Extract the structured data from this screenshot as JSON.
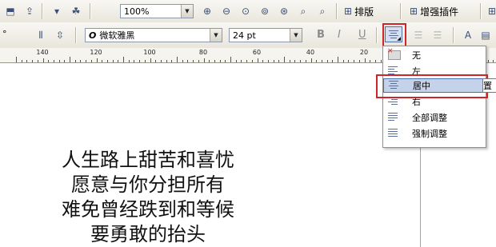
{
  "toolbar1": {
    "zoom_value": "100%",
    "layout_label": "排版",
    "plugin_label": "增强插件"
  },
  "toolbar2": {
    "font_name": "微软雅黑",
    "font_size": "24 pt",
    "bold_glyph": "B",
    "italic_glyph": "I",
    "underline_glyph": "U",
    "partial_right_text": "置"
  },
  "ruler": {
    "labels": [
      "140",
      "120",
      "100",
      "80",
      "60",
      "40",
      "20"
    ]
  },
  "alignment_menu": {
    "items": [
      {
        "label": "无",
        "selected": false
      },
      {
        "label": "左",
        "selected": false
      },
      {
        "label": "居中",
        "selected": true
      },
      {
        "label": "右",
        "selected": false
      },
      {
        "label": "全部调整",
        "selected": false
      },
      {
        "label": "强制调整",
        "selected": false
      }
    ]
  },
  "canvas": {
    "lines": [
      "人生路上甜苦和喜忧",
      "愿意与你分担所有",
      "难免曾经跌到和等候",
      "要勇敢的抬头"
    ]
  },
  "colors": {
    "highlight": "#d0242b",
    "selection": "#c5d3ea"
  }
}
